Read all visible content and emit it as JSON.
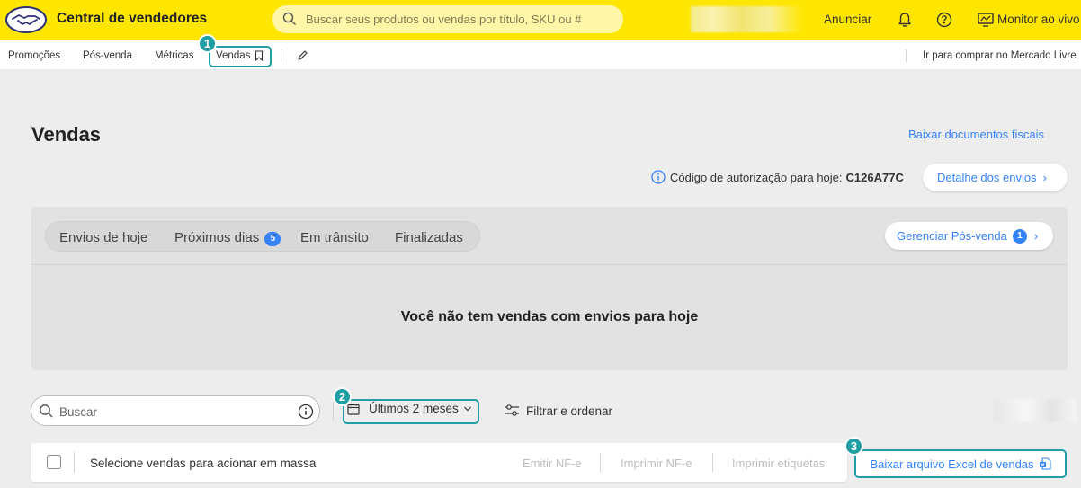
{
  "header": {
    "brand": "Central de vendedores",
    "search_placeholder": "Buscar seus produtos ou vendas por título, SKU ou #",
    "announce": "Anunciar",
    "live_monitor": "Monitor ao vivo"
  },
  "subnav": {
    "items": [
      "Promoções",
      "Pós-venda",
      "Métricas",
      "Vendas"
    ],
    "right_link": "Ir para comprar no Mercado Livre"
  },
  "callouts": [
    "1",
    "2",
    "3"
  ],
  "page": {
    "title": "Vendas",
    "fiscal_docs_link": "Baixar documentos fiscais",
    "auth_label": "Código de autorização para hoje:",
    "auth_code": "C126A77C",
    "shipments_detail": "Detalhe dos envios"
  },
  "tabs": [
    {
      "label": "Envios de hoje"
    },
    {
      "label": "Próximos dias",
      "count": "5"
    },
    {
      "label": "Em trânsito"
    },
    {
      "label": "Finalizadas"
    }
  ],
  "post_sale": {
    "label": "Gerenciar Pós-venda",
    "count": "1"
  },
  "empty_message": "Você não tem vendas com envios para hoje",
  "toolbar": {
    "search_placeholder": "Buscar",
    "period": "Últimos 2 meses",
    "filter": "Filtrar e ordenar"
  },
  "bulk": {
    "label": "Selecione vendas para acionar em massa",
    "actions": [
      "Emitir NF-e",
      "Imprimir NF-e",
      "Imprimir etiquetas"
    ],
    "excel": "Baixar arquivo Excel de vendas"
  },
  "colors": {
    "brand_yellow": "#ffe600",
    "accent_blue": "#3483fa",
    "callout_teal": "#1f9ea3"
  }
}
